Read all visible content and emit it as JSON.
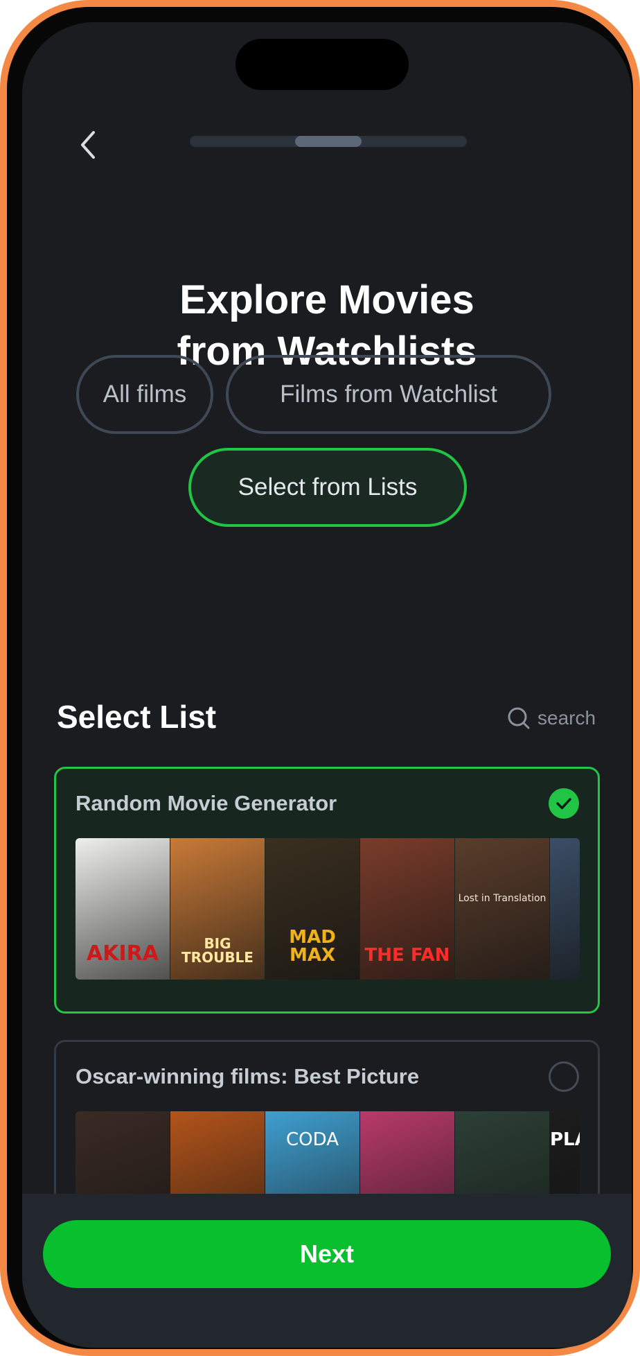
{
  "header": {
    "back_icon": "chevron-left-icon",
    "progress_fraction": 0.5
  },
  "title": {
    "line1": "Explore Movies",
    "line2": "from Watchlists"
  },
  "filters": [
    {
      "label": "All films",
      "selected": false
    },
    {
      "label": "Films from Watchlist",
      "selected": false
    },
    {
      "label": "Select from Lists",
      "selected": true
    }
  ],
  "section": {
    "title": "Select List",
    "search_icon": "search-icon",
    "search_label": "search"
  },
  "lists": [
    {
      "title": "Random Movie Generator",
      "selected": true,
      "posters": [
        {
          "title": "AKIRA",
          "bg": "#eeeeea",
          "fg": "#cc1a1a"
        },
        {
          "title": "BIG TROUBLE",
          "bg": "#c87a37",
          "fg": "#ffe9a0"
        },
        {
          "title": "MAD MAX",
          "bg": "#3a2f1f",
          "fg": "#f0b21a"
        },
        {
          "title": "THE FAN",
          "bg": "#7a3c2a",
          "fg": "#ff2a2a"
        },
        {
          "title": "Lost in Translation",
          "bg": "#5a3d2b",
          "fg": "#f2e6d4"
        },
        {
          "title": "",
          "bg": "#3a4e66",
          "fg": "#ffffff"
        }
      ]
    },
    {
      "title": "Oscar-winning films: Best Picture",
      "selected": false,
      "posters": [
        {
          "title": "",
          "bg": "#3a2a24",
          "fg": "#ffffff"
        },
        {
          "title": "",
          "bg": "#b3541a",
          "fg": "#ffffff"
        },
        {
          "title": "CODA",
          "bg": "#3f9fd0",
          "fg": "#ffffff"
        },
        {
          "title": "",
          "bg": "#b83a6a",
          "fg": "#ffffff"
        },
        {
          "title": "",
          "bg": "#2c4036",
          "fg": "#ffffff"
        },
        {
          "title": "PLA",
          "bg": "#1c1c1c",
          "fg": "#ffffff"
        }
      ]
    }
  ],
  "footer": {
    "next_label": "Next"
  },
  "colors": {
    "accent": "#08bf2e",
    "background": "#1a1c1f",
    "frame": "#f38944"
  }
}
